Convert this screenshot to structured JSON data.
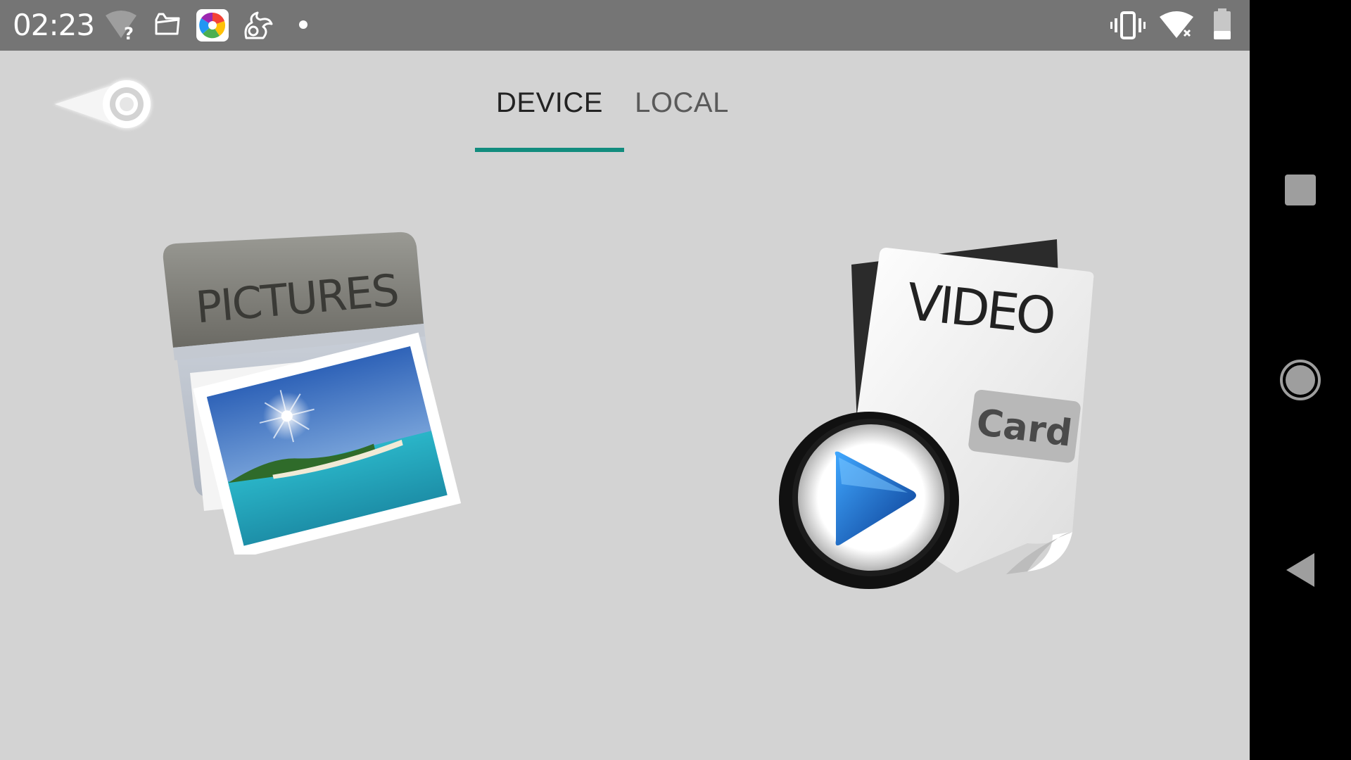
{
  "status_bar": {
    "time": "02:23",
    "left_icons": [
      "wifi-question-icon",
      "folder-outline-icon",
      "colorful-app-icon",
      "squirrel-app-icon",
      "notification-dot-icon"
    ],
    "right_icons": [
      "vibrate-icon",
      "wifi-disconnected-icon",
      "battery-icon"
    ]
  },
  "app": {
    "tabs": [
      {
        "label": "DEVICE",
        "selected": true
      },
      {
        "label": "LOCAL",
        "selected": false
      }
    ],
    "tiles": {
      "pictures": {
        "label": "PICTURES"
      },
      "video": {
        "label": "VIDEO",
        "badge": "Card"
      }
    }
  },
  "nav_bar": {
    "buttons": [
      "recents-square-icon",
      "home-circle-icon",
      "back-triangle-icon"
    ]
  },
  "colors": {
    "status_bar_bg": "#757575",
    "app_bg": "#d3d3d3",
    "tab_indicator": "#128c7e",
    "nav_bar_bg": "#000000"
  }
}
